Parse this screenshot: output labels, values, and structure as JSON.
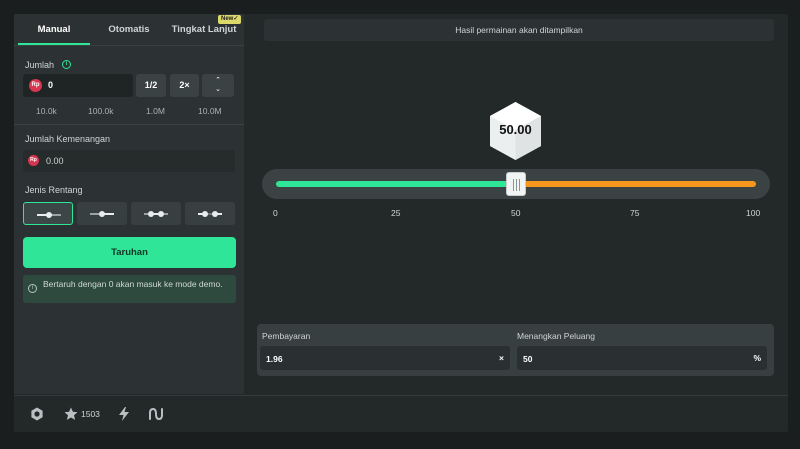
{
  "tabs": {
    "manual": "Manual",
    "auto": "Otomatis",
    "advanced": "Tingkat Lanjut",
    "new_badge": "New✓"
  },
  "amount": {
    "label": "Jumlah",
    "currency_icon": "Rp",
    "value": "0",
    "half_label": "1/2",
    "double_label": "2×",
    "up_label": "⌃",
    "down_label": "⌄",
    "quick_amounts": [
      "10.0k",
      "100.0k",
      "1.0M",
      "10.0M"
    ]
  },
  "winnings": {
    "label": "Jumlah Kemenangan",
    "currency_icon": "Rp",
    "value": "0.00"
  },
  "range_type": {
    "label": "Jenis Rentang",
    "options": [
      "range-under-icon",
      "range-over-icon",
      "range-between-icon",
      "range-outside-icon"
    ],
    "selected_index": 0
  },
  "bet_button": "Taruhan",
  "notice": {
    "icon": "info-icon",
    "text": "Bertaruh dengan 0 akan masuk ke mode demo."
  },
  "result_bar": "Hasil permainan akan ditampilkan",
  "dice": {
    "value": "50.00"
  },
  "slider": {
    "value": 50,
    "min": 0,
    "max": 100,
    "ticks": [
      "0",
      "25",
      "50",
      "75",
      "100"
    ],
    "colors": {
      "low": "#2ee598",
      "high": "#f6971e"
    }
  },
  "payout": {
    "label": "Pembayaran",
    "value": "1.96",
    "unit": "×"
  },
  "win_chance": {
    "label": "Menangkan Peluang",
    "value": "50",
    "unit": "%"
  },
  "footer": {
    "settings_icon": "settings-icon",
    "star_icon": "star-icon",
    "star_count": "1503",
    "bolt_icon": "bolt-icon",
    "stats_icon": "stats-icon"
  },
  "colors": {
    "accent": "#2ee598",
    "orange": "#f6971e",
    "panel": "#2c3233",
    "background": "#1b1e1f"
  }
}
